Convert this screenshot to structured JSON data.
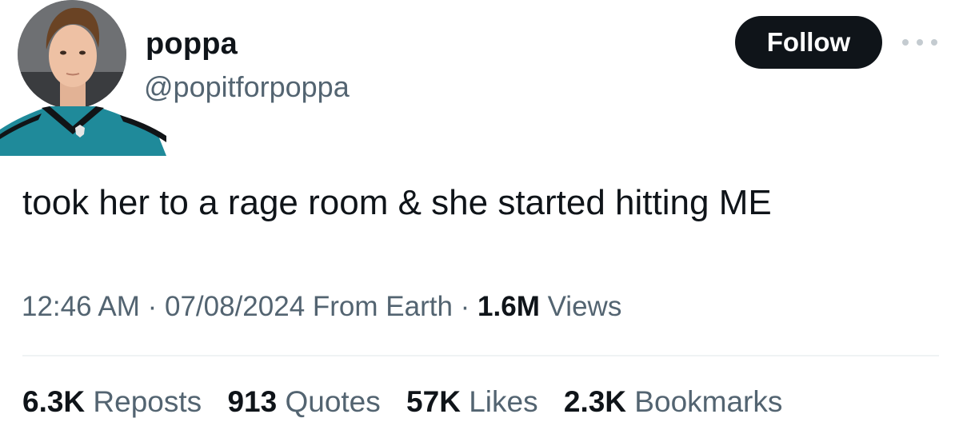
{
  "user": {
    "display_name": "poppa",
    "handle": "@popitforpoppa",
    "avatar_icon": "profile-photo-hockey-jersey",
    "jersey_color": "#1f8a9a"
  },
  "follow_button": {
    "label": "Follow",
    "background": "#0f1419"
  },
  "more_icon": "more-horizontal-icon",
  "tweet": {
    "text": "took her to a rage room & she started hitting ME"
  },
  "meta": {
    "time": "12:46 AM",
    "sep1": " · ",
    "date": "07/08/2024",
    "location": " From Earth",
    "sep2": " · ",
    "views_count": "1.6M",
    "views_label": " Views"
  },
  "stats": [
    {
      "count": "6.3K",
      "label": " Reposts"
    },
    {
      "count": "913",
      "label": " Quotes"
    },
    {
      "count": "57K",
      "label": " Likes"
    },
    {
      "count": "2.3K",
      "label": " Bookmarks"
    }
  ]
}
